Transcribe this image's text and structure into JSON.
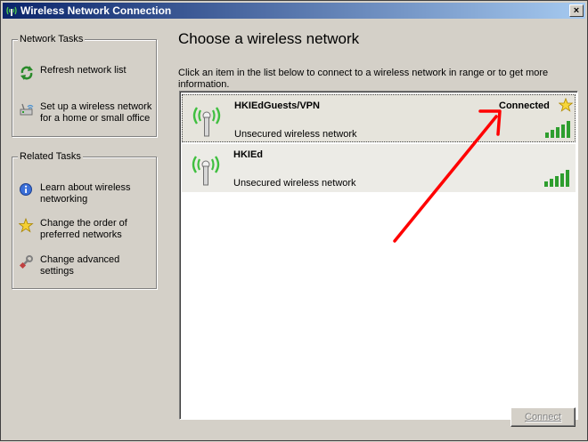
{
  "window": {
    "title": "Wireless Network Connection",
    "close_glyph": "×"
  },
  "sidebar": {
    "network_tasks": {
      "title": "Network Tasks",
      "items": [
        {
          "label": "Refresh network list",
          "icon": "refresh-icon"
        },
        {
          "label": "Set up a wireless network for a home or small office",
          "icon": "setup-wireless-icon"
        }
      ]
    },
    "related_tasks": {
      "title": "Related Tasks",
      "items": [
        {
          "label": "Learn about wireless networking",
          "icon": "info-icon"
        },
        {
          "label": "Change the order of preferred networks",
          "icon": "star-icon"
        },
        {
          "label": "Change advanced settings",
          "icon": "wrench-icon"
        }
      ]
    }
  },
  "main": {
    "title": "Choose a wireless network",
    "instructions": "Click an item in the list below to connect to a wireless network in range or to get more information.",
    "networks": [
      {
        "ssid": "HKIEdGuests/VPN",
        "security": "Unsecured wireless network",
        "status": "Connected",
        "signal_bars": 5,
        "preferred": true
      },
      {
        "ssid": "HKIEd",
        "security": "Unsecured wireless network",
        "status": "",
        "signal_bars": 5,
        "preferred": false
      }
    ],
    "connect_label": "Connect"
  },
  "colors": {
    "titlebar_start": "#0a246a",
    "titlebar_end": "#a6caf0",
    "signal_green": "#2e9e2e",
    "arrow_red": "#ff0000"
  }
}
